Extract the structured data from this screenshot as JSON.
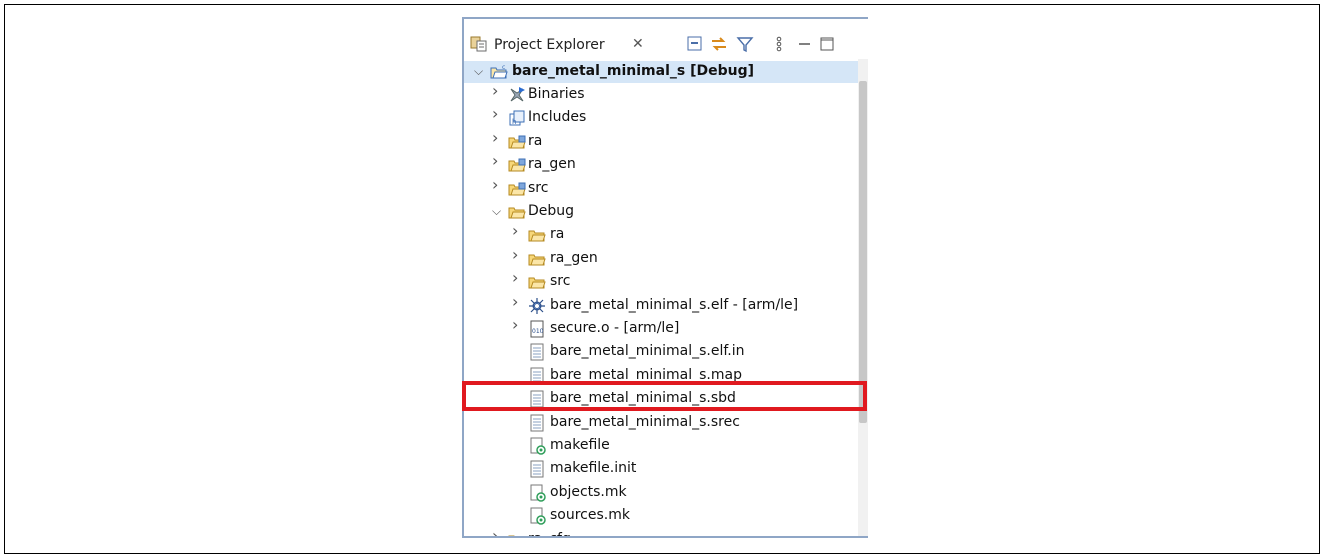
{
  "view": {
    "title": "Project Explorer",
    "close_glyph": "✕",
    "toolbar_icons": [
      "collapse-all-icon",
      "link-with-editor-icon",
      "filter-icon",
      "view-menu-icon",
      "minimize-icon",
      "maximize-icon"
    ]
  },
  "tree": {
    "project": {
      "label": "bare_metal_minimal_s [Debug]",
      "expanded": true
    },
    "items": [
      {
        "label": "Binaries",
        "icon": "binaries-icon"
      },
      {
        "label": "Includes",
        "icon": "includes-icon"
      },
      {
        "label": "ra",
        "icon": "source-folder-icon"
      },
      {
        "label": "ra_gen",
        "icon": "source-folder-icon"
      },
      {
        "label": "src",
        "icon": "source-folder-icon"
      },
      {
        "label": "Debug",
        "icon": "folder-open-icon"
      },
      {
        "label": "ra",
        "icon": "folder-icon"
      },
      {
        "label": "ra_gen",
        "icon": "folder-icon"
      },
      {
        "label": "src",
        "icon": "folder-icon"
      },
      {
        "label": "bare_metal_minimal_s.elf - [arm/le]",
        "icon": "elf-binary-icon"
      },
      {
        "label": "secure.o - [arm/le]",
        "icon": "object-file-icon"
      },
      {
        "label": "bare_metal_minimal_s.elf.in",
        "icon": "text-file-icon"
      },
      {
        "label": "bare_metal_minimal_s.map",
        "icon": "text-file-icon"
      },
      {
        "label": "bare_metal_minimal_s.sbd",
        "icon": "text-file-icon"
      },
      {
        "label": "bare_metal_minimal_s.srec",
        "icon": "text-file-icon"
      },
      {
        "label": "makefile",
        "icon": "makefile-icon"
      },
      {
        "label": "makefile.init",
        "icon": "text-file-icon"
      },
      {
        "label": "objects.mk",
        "icon": "makefile-icon"
      },
      {
        "label": "sources.mk",
        "icon": "makefile-icon"
      },
      {
        "label": "ra_cfg",
        "icon": "folder-icon"
      }
    ]
  },
  "highlight": {
    "target": "bare_metal_minimal_s.sbd",
    "color": "#e0191f"
  }
}
